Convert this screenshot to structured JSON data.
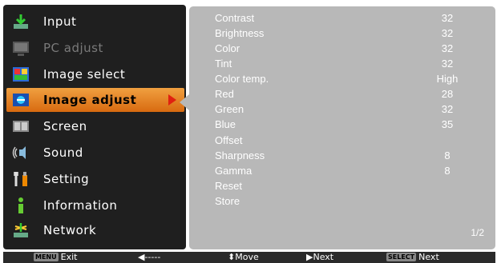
{
  "menu": {
    "items": [
      {
        "label": "Input",
        "icon": "input-icon",
        "disabled": false,
        "active": false
      },
      {
        "label": "PC adjust",
        "icon": "pc-adjust-icon",
        "disabled": true,
        "active": false
      },
      {
        "label": "Image select",
        "icon": "image-select-icon",
        "disabled": false,
        "active": false
      },
      {
        "label": "Image adjust",
        "icon": "image-adjust-icon",
        "disabled": false,
        "active": true
      },
      {
        "label": "Screen",
        "icon": "screen-icon",
        "disabled": false,
        "active": false
      },
      {
        "label": "Sound",
        "icon": "sound-icon",
        "disabled": false,
        "active": false
      },
      {
        "label": "Setting",
        "icon": "setting-icon",
        "disabled": false,
        "active": false
      },
      {
        "label": "Information",
        "icon": "information-icon",
        "disabled": false,
        "active": false
      },
      {
        "label": "Network",
        "icon": "network-icon",
        "disabled": false,
        "active": false
      }
    ]
  },
  "panel": {
    "rows": [
      {
        "label": "Contrast",
        "value": "32"
      },
      {
        "label": "Brightness",
        "value": "32"
      },
      {
        "label": "Color",
        "value": "32"
      },
      {
        "label": "Tint",
        "value": "32"
      },
      {
        "label": "Color temp.",
        "value": "High"
      },
      {
        "label": "Red",
        "value": "28"
      },
      {
        "label": "Green",
        "value": "32"
      },
      {
        "label": "Blue",
        "value": "35"
      },
      {
        "label": "Offset",
        "value": ""
      },
      {
        "label": "Sharpness",
        "value": "8"
      },
      {
        "label": "Gamma",
        "value": "8"
      },
      {
        "label": "Reset",
        "value": ""
      },
      {
        "label": "Store",
        "value": ""
      }
    ],
    "page_indicator": "1/2"
  },
  "bottombar": {
    "exit_key": "MENU",
    "exit_label": "Exit",
    "back_label": "◀-----",
    "move_label": "⬍Move",
    "next_label": "▶Next",
    "select_key": "SELECT",
    "select_next_label": "Next"
  },
  "colors": {
    "menu_bg": "#1f1f1f",
    "panel_bg": "#b8b8b8",
    "active_item": "#e8882a",
    "active_arrow": "#e02010"
  }
}
